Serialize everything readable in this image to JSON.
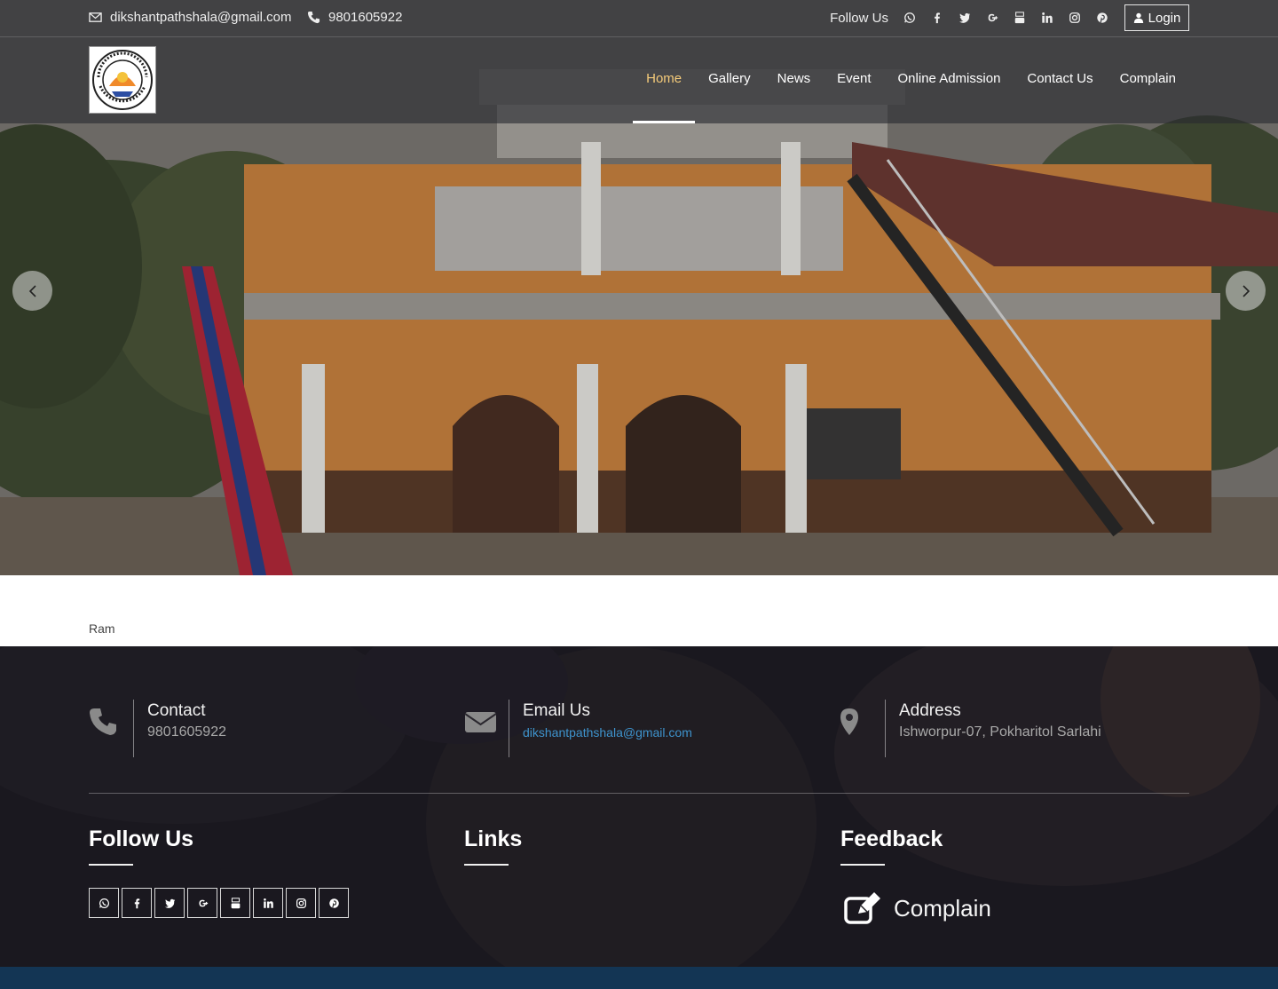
{
  "topbar": {
    "email": "dikshantpathshala@gmail.com",
    "phone": "9801605922",
    "follow_label": "Follow Us",
    "social": [
      "whatsapp-icon",
      "facebook-icon",
      "twitter-icon",
      "google-plus-icon",
      "youtube-icon",
      "linkedin-icon",
      "instagram-icon",
      "pinterest-icon"
    ],
    "login_label": "Login"
  },
  "nav": {
    "items": [
      "Home",
      "Gallery",
      "News",
      "Event",
      "Online Admission",
      "Contact Us",
      "Complain"
    ],
    "active": "Home"
  },
  "strip": {
    "text": "Ram"
  },
  "footer": {
    "contact": {
      "title": "Contact",
      "value": "9801605922"
    },
    "email": {
      "title": "Email Us",
      "value": "dikshantpathshala@gmail.com"
    },
    "address": {
      "title": "Address",
      "value": "Ishworpur-07, Pokharitol Sarlahi"
    },
    "follow_heading": "Follow Us",
    "links_heading": "Links",
    "feedback_heading": "Feedback",
    "complain_label": "Complain"
  },
  "colors": {
    "accent_active": "#f5cb7a",
    "email_link": "#3e93cd",
    "bottom_bar": "#133554"
  }
}
